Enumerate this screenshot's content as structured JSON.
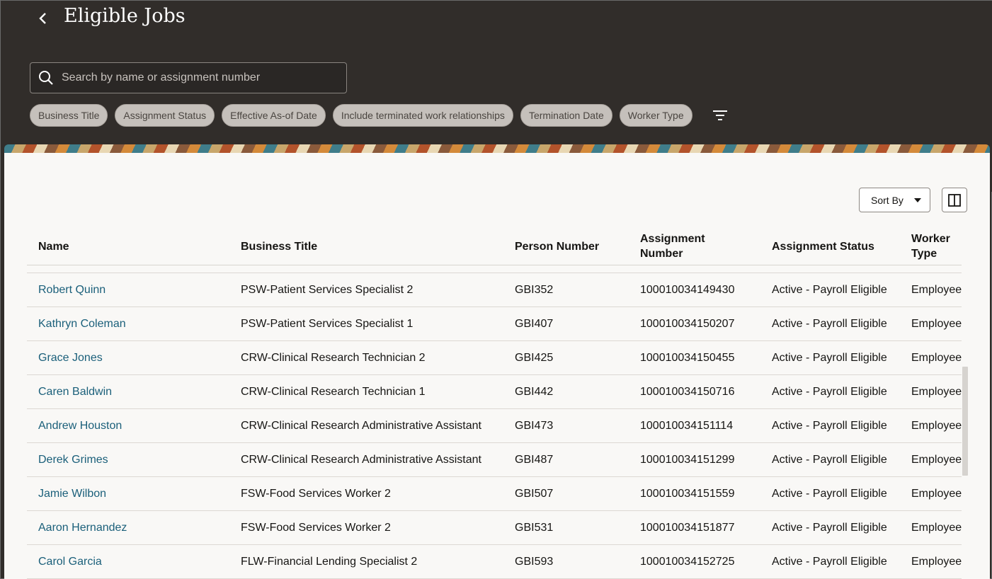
{
  "header": {
    "title": "Eligible Jobs",
    "search_placeholder": "Search by name or assignment number",
    "filters": [
      "Business Title",
      "Assignment Status",
      "Effective As-of Date",
      "Include terminated work relationships",
      "Termination Date",
      "Worker Type"
    ]
  },
  "toolbar": {
    "sort_label": "Sort By"
  },
  "table": {
    "columns": [
      "Name",
      "Business Title",
      "Person Number",
      "Assignment Number",
      "Assignment Status",
      "Worker Type"
    ],
    "columns_wrapped": {
      "assignment_number": [
        "Assignment",
        "Number"
      ],
      "worker_type": [
        "Worker",
        "Type"
      ]
    },
    "rows": [
      {
        "name": "Robert Quinn",
        "title": "PSW-Patient Services Specialist 2",
        "person": "GBI352",
        "assignment": "100010034149430",
        "status": "Active - Payroll Eligible",
        "type": "Employee"
      },
      {
        "name": "Kathryn Coleman",
        "title": "PSW-Patient Services Specialist 1",
        "person": "GBI407",
        "assignment": "100010034150207",
        "status": "Active - Payroll Eligible",
        "type": "Employee"
      },
      {
        "name": "Grace Jones",
        "title": "CRW-Clinical Research Technician 2",
        "person": "GBI425",
        "assignment": "100010034150455",
        "status": "Active - Payroll Eligible",
        "type": "Employee"
      },
      {
        "name": "Caren Baldwin",
        "title": "CRW-Clinical Research Technician 1",
        "person": "GBI442",
        "assignment": "100010034150716",
        "status": "Active - Payroll Eligible",
        "type": "Employee"
      },
      {
        "name": "Andrew Houston",
        "title": "CRW-Clinical Research Administrative Assistant",
        "person": "GBI473",
        "assignment": "100010034151114",
        "status": "Active - Payroll Eligible",
        "type": "Employee"
      },
      {
        "name": "Derek Grimes",
        "title": "CRW-Clinical Research Administrative Assistant",
        "person": "GBI487",
        "assignment": "100010034151299",
        "status": "Active - Payroll Eligible",
        "type": "Employee"
      },
      {
        "name": "Jamie Wilbon",
        "title": "FSW-Food Services Worker 2",
        "person": "GBI507",
        "assignment": "100010034151559",
        "status": "Active - Payroll Eligible",
        "type": "Employee"
      },
      {
        "name": "Aaron Hernandez",
        "title": "FSW-Food Services Worker 2",
        "person": "GBI531",
        "assignment": "100010034151877",
        "status": "Active - Payroll Eligible",
        "type": "Employee"
      },
      {
        "name": "Carol Garcia",
        "title": "FLW-Financial Lending Specialist 2",
        "person": "GBI593",
        "assignment": "100010034152725",
        "status": "Active - Payroll Eligible",
        "type": "Employee"
      }
    ]
  },
  "colors": {
    "header_bg": "#312d2a",
    "panel_bg": "#f9f8f6",
    "link": "#1a5f7a",
    "chip_bg": "#c5c0bb"
  },
  "icons": [
    "back-chevron-icon",
    "search-icon",
    "filter-icon",
    "caret-down-icon",
    "panel-layout-icon"
  ]
}
